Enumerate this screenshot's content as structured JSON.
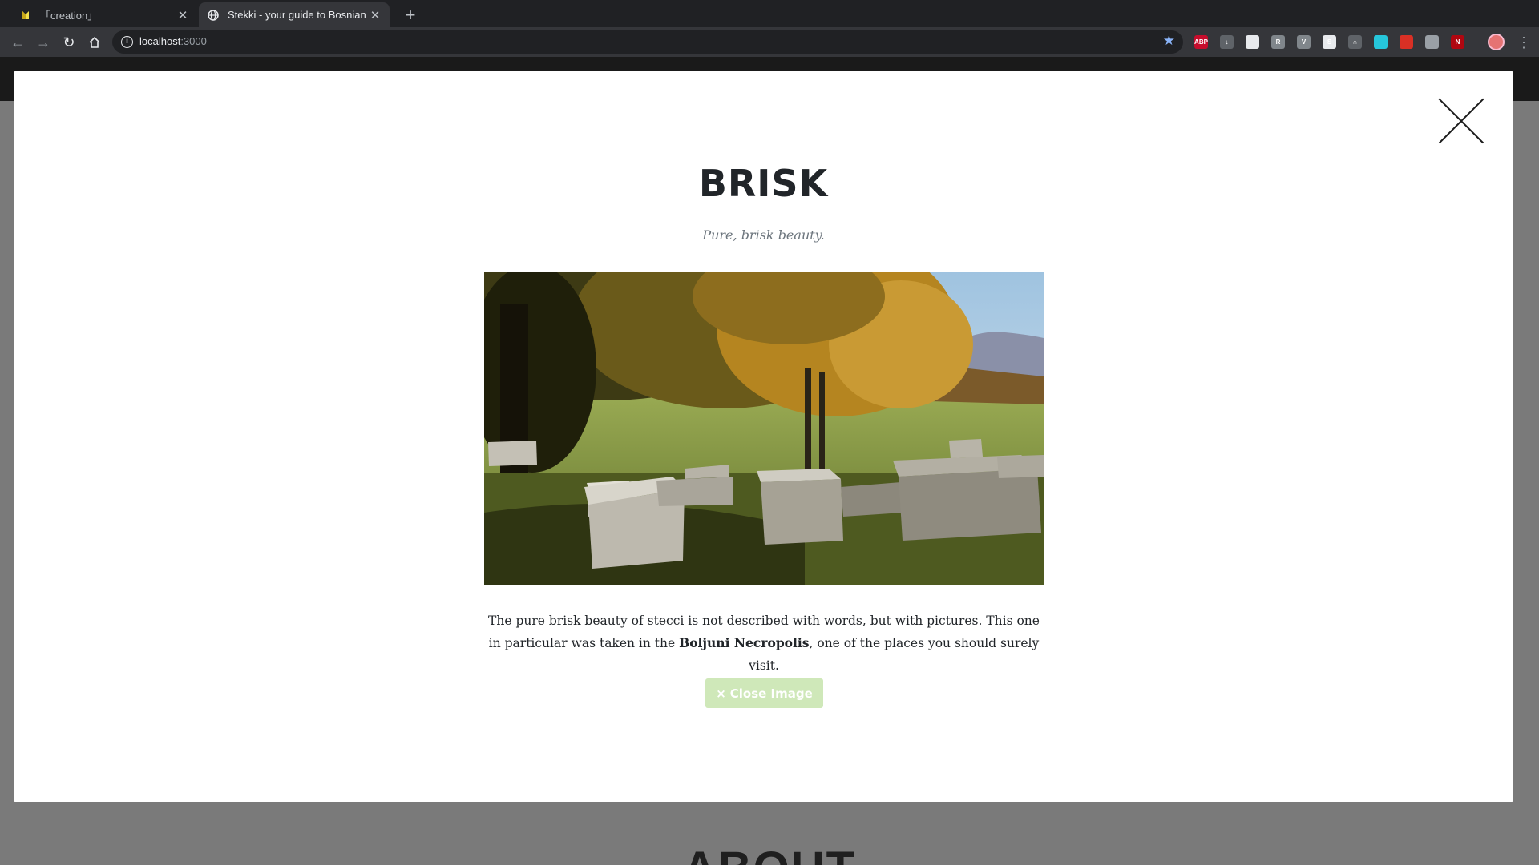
{
  "browser": {
    "tabs": [
      {
        "title": "「creation」",
        "active": false
      },
      {
        "title": "Stekki - your guide to Bosnian b",
        "active": true
      }
    ],
    "url_host": "localhost",
    "url_port": ":3000",
    "extensions": [
      {
        "name": "adblock-plus-icon",
        "label": "ABP",
        "color": "#c70d2c"
      },
      {
        "name": "download-icon",
        "label": "↓",
        "color": "#5f6368"
      },
      {
        "name": "calendar-icon",
        "label": "",
        "color": "#e8eaed"
      },
      {
        "name": "extension-r-icon",
        "label": "R",
        "color": "#80868b"
      },
      {
        "name": "vue-devtools-icon",
        "label": "V",
        "color": "#80868b"
      },
      {
        "name": "extension-s-icon",
        "label": "S",
        "color": "#e8eaed"
      },
      {
        "name": "extension-n-icon",
        "label": "∩",
        "color": "#5f6368"
      },
      {
        "name": "filter-icon",
        "label": "",
        "color": "#26c6da"
      },
      {
        "name": "notifications-icon",
        "label": "",
        "color": "#d93025"
      },
      {
        "name": "copy-icon",
        "label": "",
        "color": "#9aa0a6"
      },
      {
        "name": "netflix-icon",
        "label": "N",
        "color": "#b00710"
      }
    ]
  },
  "modal": {
    "title": "BRISK",
    "subtitle": "Pure, brisk beauty.",
    "description_prefix": "The pure brisk beauty of stecci is not described with words, but with pictures. This one in particular was taken in the ",
    "description_bold": "Boljuni Necropolis",
    "description_suffix": ", one of the places you should surely visit.",
    "close_button_label": "Close Image",
    "close_button_icon": "×"
  },
  "background_page": {
    "section_heading": "ABOUT"
  }
}
